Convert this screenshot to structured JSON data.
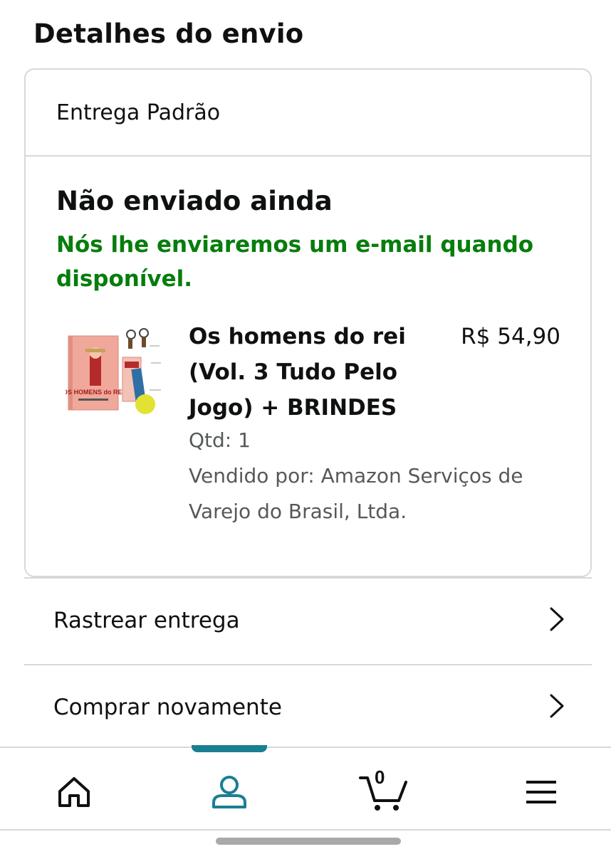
{
  "header": {
    "title": "Detalhes do envio"
  },
  "shipment": {
    "method": "Entrega Padrão",
    "status": "Não enviado ainda",
    "status_note": "Nós lhe enviaremos um e-mail quando disponível.",
    "status_color": "#067d0c"
  },
  "item": {
    "title": "Os homens do rei (Vol. 3 Tudo Pelo Jogo) + BRINDES",
    "price": "R$ 54,90",
    "quantity": "Qtd: 1",
    "seller": "Vendido por: Amazon Serviços de Varejo do Brasil, Ltda.",
    "cover_text": "OS HOMENS do REI"
  },
  "actions": {
    "track": "Rastrear entrega",
    "buy_again": "Comprar novamente"
  },
  "nav": {
    "items": [
      "home-icon",
      "account-icon",
      "cart-icon",
      "menu-icon"
    ],
    "cart_count": "0",
    "active_color": "#1a7f93"
  }
}
